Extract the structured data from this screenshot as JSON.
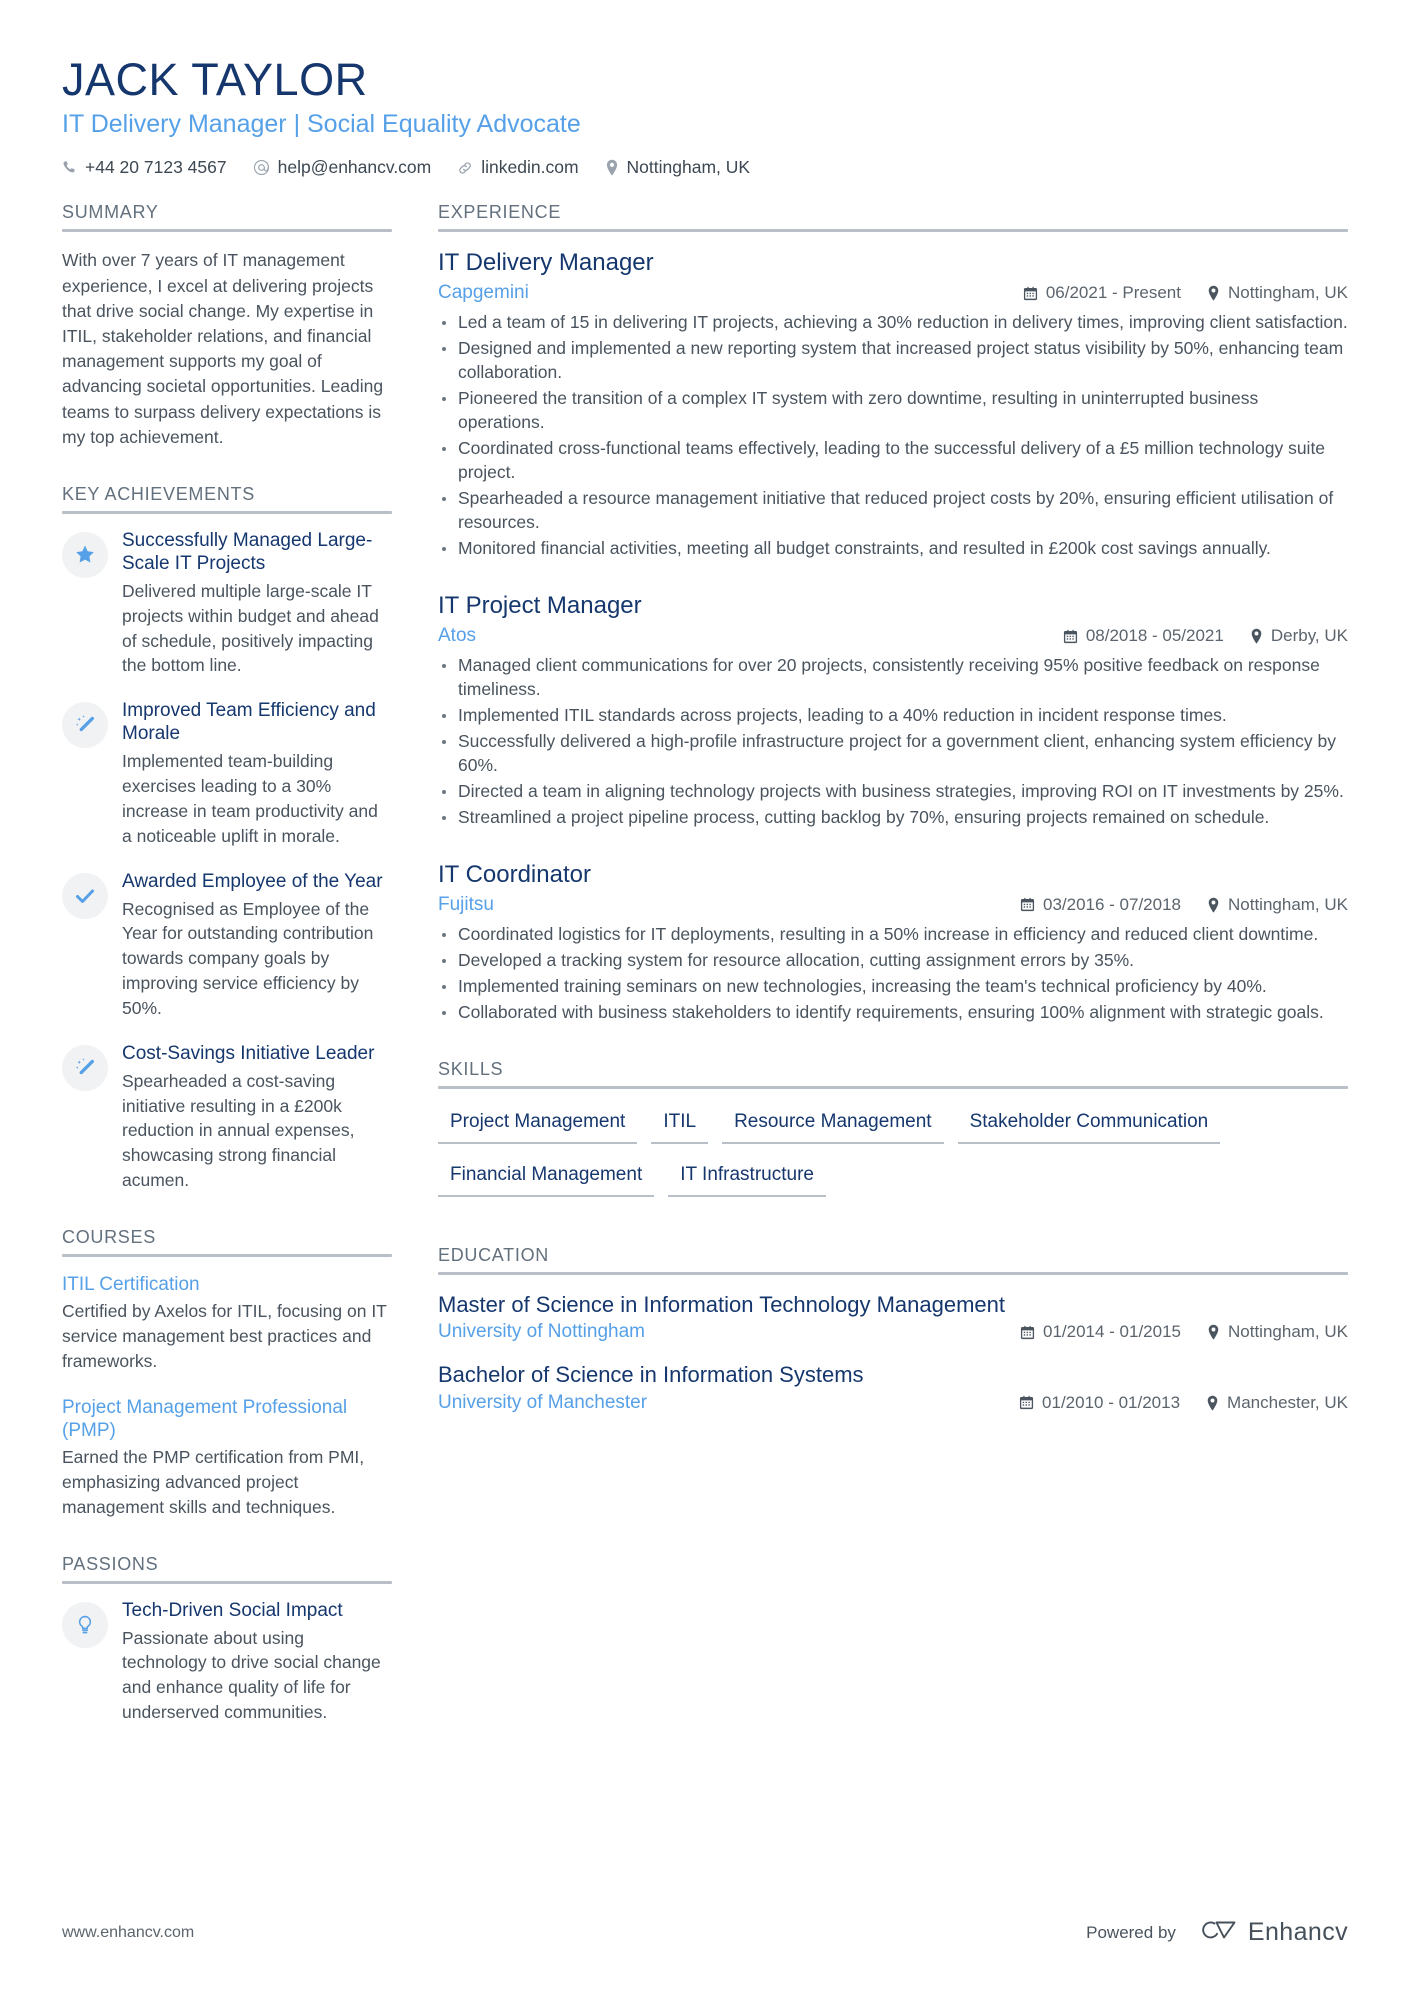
{
  "header": {
    "full_name": "JACK TAYLOR",
    "job_title": "IT Delivery Manager | Social Equality Advocate",
    "contacts": [
      {
        "icon": "phone-icon",
        "text": "+44 20 7123 4567"
      },
      {
        "icon": "email-icon",
        "text": "help@enhancv.com"
      },
      {
        "icon": "link-icon",
        "text": "linkedin.com"
      },
      {
        "icon": "location-pin-icon",
        "text": "Nottingham, UK"
      }
    ]
  },
  "sections": {
    "summary": {
      "title": "SUMMARY",
      "text": "With over 7 years of IT management experience, I excel at delivering projects that drive social change. My expertise in ITIL, stakeholder relations, and financial management supports my goal of advancing societal opportunities. Leading teams to surpass delivery expectations is my top achievement."
    },
    "key_achievements": {
      "title": "KEY ACHIEVEMENTS",
      "items": [
        {
          "icon": "star-icon",
          "title": "Successfully Managed Large-Scale IT Projects",
          "description": "Delivered multiple large-scale IT projects within budget and ahead of schedule, positively impacting the bottom line."
        },
        {
          "icon": "magic-wand-icon",
          "title": "Improved Team Efficiency and Morale",
          "description": "Implemented team-building exercises leading to a 30% increase in team productivity and a noticeable uplift in morale."
        },
        {
          "icon": "check-icon",
          "title": "Awarded Employee of the Year",
          "description": "Recognised as Employee of the Year for outstanding contribution towards company goals by improving service efficiency by 50%."
        },
        {
          "icon": "magic-wand-icon",
          "title": "Cost-Savings Initiative Leader",
          "description": "Spearheaded a cost-saving initiative resulting in a £200k reduction in annual expenses, showcasing strong financial acumen."
        }
      ]
    },
    "courses": {
      "title": "COURSES",
      "items": [
        {
          "title": "ITIL Certification",
          "description": "Certified by Axelos for ITIL, focusing on IT service management best practices and frameworks."
        },
        {
          "title": "Project Management Professional (PMP)",
          "description": "Earned the PMP certification from PMI, emphasizing advanced project management skills and techniques."
        }
      ]
    },
    "passions": {
      "title": "PASSIONS",
      "items": [
        {
          "icon": "lightbulb-icon",
          "title": "Tech-Driven Social Impact",
          "description": "Passionate about using technology to drive social change and enhance quality of life for underserved communities."
        }
      ]
    },
    "experience": {
      "title": "EXPERIENCE",
      "items": [
        {
          "role": "IT Delivery Manager",
          "company": "Capgemini",
          "dates": "06/2021 - Present",
          "location": "Nottingham, UK",
          "bullets": [
            "Led a team of 15 in delivering IT projects, achieving a 30% reduction in delivery times, improving client satisfaction.",
            "Designed and implemented a new reporting system that increased project status visibility by 50%, enhancing team collaboration.",
            "Pioneered the transition of a complex IT system with zero downtime, resulting in uninterrupted business operations.",
            "Coordinated cross-functional teams effectively, leading to the successful delivery of a £5 million technology suite project.",
            "Spearheaded a resource management initiative that reduced project costs by 20%, ensuring efficient utilisation of resources.",
            "Monitored financial activities, meeting all budget constraints, and resulted in £200k cost savings annually."
          ]
        },
        {
          "role": "IT Project Manager",
          "company": "Atos",
          "dates": "08/2018 - 05/2021",
          "location": "Derby, UK",
          "bullets": [
            "Managed client communications for over 20 projects, consistently receiving 95% positive feedback on response timeliness.",
            "Implemented ITIL standards across projects, leading to a 40% reduction in incident response times.",
            "Successfully delivered a high-profile infrastructure project for a government client, enhancing system efficiency by 60%.",
            "Directed a team in aligning technology projects with business strategies, improving ROI on IT investments by 25%.",
            "Streamlined a project pipeline process, cutting backlog by 70%, ensuring projects remained on schedule."
          ]
        },
        {
          "role": "IT Coordinator",
          "company": "Fujitsu",
          "dates": "03/2016 - 07/2018",
          "location": "Nottingham, UK",
          "bullets": [
            "Coordinated logistics for IT deployments, resulting in a 50% increase in efficiency and reduced client downtime.",
            "Developed a tracking system for resource allocation, cutting assignment errors by 35%.",
            "Implemented training seminars on new technologies, increasing the team's technical proficiency by 40%.",
            "Collaborated with business stakeholders to identify requirements, ensuring 100% alignment with strategic goals."
          ]
        }
      ]
    },
    "skills": {
      "title": "SKILLS",
      "items": [
        "Project Management",
        "ITIL",
        "Resource Management",
        "Stakeholder Communication",
        "Financial Management",
        "IT Infrastructure"
      ]
    },
    "education": {
      "title": "EDUCATION",
      "items": [
        {
          "degree": "Master of Science in Information Technology Management",
          "school": "University of Nottingham",
          "dates": "01/2014 - 01/2015",
          "location": "Nottingham, UK"
        },
        {
          "degree": "Bachelor of Science in Information Systems",
          "school": "University of Manchester",
          "dates": "01/2010 - 01/2013",
          "location": "Manchester, UK"
        }
      ]
    }
  },
  "footer": {
    "url": "www.enhancv.com",
    "powered_by": "Powered by",
    "brand_name": "Enhancv"
  },
  "colors": {
    "navy": "#15376e",
    "light_blue": "#56a0e8",
    "body_text": "#4a545e",
    "rule": "#b8bfc6"
  }
}
